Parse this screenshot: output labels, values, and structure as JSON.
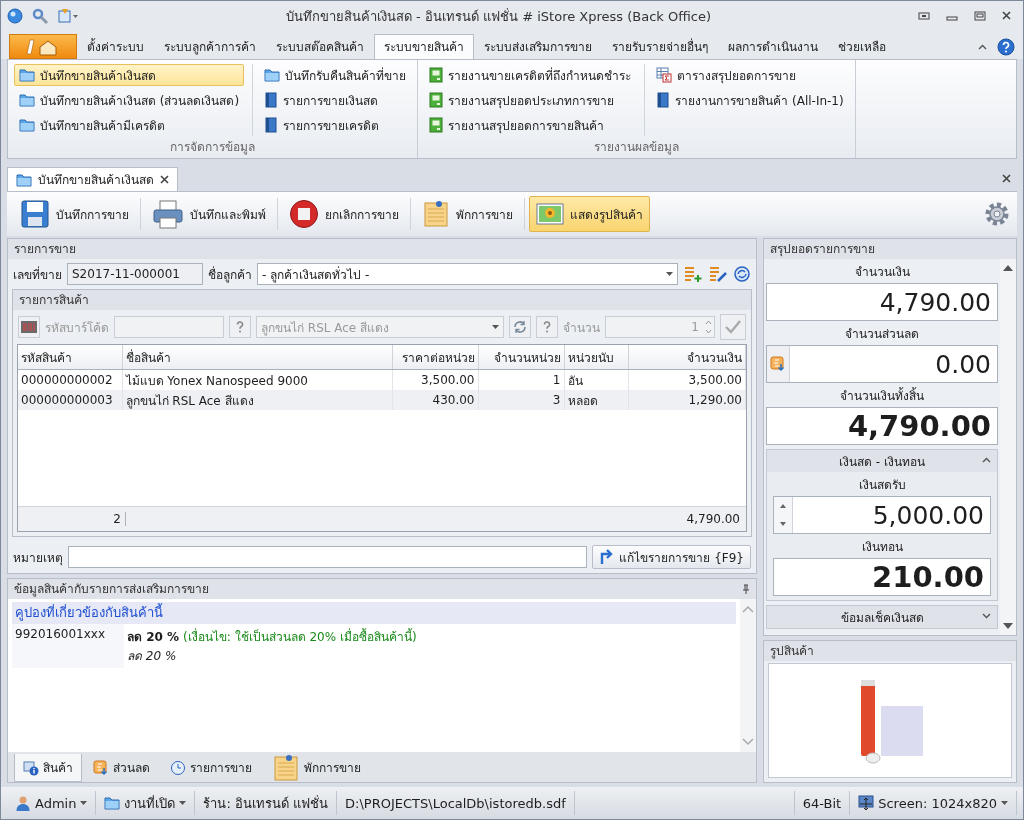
{
  "window": {
    "title": "บันทึกขายสินค้าเงินสด - อินเทรนด์ แฟชั่น # iStore Xpress (Back Office)"
  },
  "ribbon": {
    "tabs": [
      {
        "label": "ตั้งค่าระบบ",
        "selected": false
      },
      {
        "label": "ระบบลูกค้าการค้า",
        "selected": false
      },
      {
        "label": "ระบบสต๊อคสินค้า",
        "selected": false
      },
      {
        "label": "ระบบขายสินค้า",
        "selected": true
      },
      {
        "label": "ระบบส่งเสริมการขาย",
        "selected": false
      },
      {
        "label": "รายรับรายจ่ายอื่นๆ",
        "selected": false
      },
      {
        "label": "ผลการดำเนินงาน",
        "selected": false
      },
      {
        "label": "ช่วยเหลือ",
        "selected": false
      }
    ],
    "groups": [
      {
        "label": "การจัดการข้อมูล",
        "columns": [
          [
            {
              "label": "บันทึกขายสินค้าเงินสด",
              "kind": "folder",
              "selected": true
            },
            {
              "label": "บันทึกขายสินค้าเงินสด (ส่วนลดเงินสด)",
              "kind": "folder",
              "selected": false
            },
            {
              "label": "บันทึกขายสินค้ามีเครดิต",
              "kind": "folder",
              "selected": false
            }
          ],
          [
            {
              "label": "บันทึกรับคืนสินค้าที่ขาย",
              "kind": "folder",
              "selected": false
            },
            {
              "label": "รายการขายเงินสด",
              "kind": "book",
              "selected": false
            },
            {
              "label": "รายการขายเครดิต",
              "kind": "book",
              "selected": false
            }
          ]
        ]
      },
      {
        "label": "รายงานผลข้อมูล",
        "columns": [
          [
            {
              "label": "รายงานขายเครดิตที่ถึงกำหนดชำระ",
              "kind": "report",
              "selected": false
            },
            {
              "label": "รายงานสรุปยอดประเภทการขาย",
              "kind": "report",
              "selected": false
            },
            {
              "label": "รายงานสรุปยอดการขายสินค้า",
              "kind": "report",
              "selected": false
            }
          ],
          [
            {
              "label": "ตารางสรุปยอดการขาย",
              "kind": "table",
              "selected": false
            },
            {
              "label": "รายงานการขายสินค้า (All-In-1)",
              "kind": "book",
              "selected": false
            }
          ]
        ]
      }
    ]
  },
  "document_tab": {
    "label": "บันทึกขายสินค้าเงินสด"
  },
  "toolbar": [
    {
      "label": "บันทึกการขาย",
      "kind": "save",
      "on": false
    },
    {
      "label": "บันทึกและพิมพ์",
      "kind": "print",
      "on": false
    },
    {
      "label": "ยกเลิกการขาย",
      "kind": "stop",
      "on": false
    },
    {
      "label": "พักการขาย",
      "kind": "note",
      "on": false
    },
    {
      "label": "แสดงรูปสินค้า",
      "kind": "picture",
      "on": true
    }
  ],
  "sale": {
    "title": "รายการขาย",
    "number_label": "เลขที่ขาย",
    "number": "S2017-11-000001",
    "customer_label": "ชื่อลูกค้า",
    "customer": "- ลูกค้าเงินสดทั่วไป -"
  },
  "items": {
    "title": "รายการสินค้า",
    "entry": {
      "disabled": true,
      "barcode_label": "รหัสบาร์โค้ด",
      "product": "ลูกขนไก่ RSL Ace สีแดง",
      "qty_label": "จำนวน",
      "qty": "1"
    },
    "table": {
      "columns": [
        {
          "label": "รหัสสินค้า",
          "kind": "text"
        },
        {
          "label": "ชื่อสินค้า",
          "kind": "text"
        },
        {
          "label": "ราคาต่อหน่วย",
          "kind": "number"
        },
        {
          "label": "จำนวนหน่วย",
          "kind": "number"
        },
        {
          "label": "หน่วยนับ",
          "kind": "text"
        },
        {
          "label": "จำนวนเงิน",
          "kind": "number"
        }
      ],
      "rows": [
        [
          "000000000002",
          "ไม้แบด Yonex Nanospeed 9000",
          "3,500.00",
          "1",
          "อัน",
          "3,500.00"
        ],
        [
          "000000000003",
          "ลูกขนไก่ RSL Ace สีแดง",
          "430.00",
          "3",
          "หลอด",
          "1,290.00"
        ]
      ],
      "footer": {
        "count": "2",
        "total": "4,790.00"
      }
    }
  },
  "remark": {
    "label": "หมายเหตุ",
    "button": "แก้ไขรายการขาย {F9}"
  },
  "promo": {
    "title": "ข้อมูลสินค้ากับรายการส่งเสริมการขาย",
    "section": "คูปองที่เกี่ยวข้องกับสินค้านี้",
    "coupons": [
      {
        "code": "992016001xxx",
        "discount": "ลด 20 %",
        "condition": "(เงื่อนไข: ใช้เป็นส่วนลด 20% เมื่อซื้อสินค้านี้)",
        "note": "ลด 20 %"
      }
    ],
    "tabs": [
      {
        "label": "สินค้า",
        "kind": "info",
        "selected": true
      },
      {
        "label": "ส่วนลด",
        "kind": "discount",
        "selected": false
      },
      {
        "label": "รายการขาย",
        "kind": "history",
        "selected": false
      },
      {
        "label": "พักการขาย",
        "kind": "note",
        "selected": false
      }
    ]
  },
  "summary": {
    "title": "สรุปยอดรายการขาย",
    "fields": [
      {
        "label": "จำนวนเงิน",
        "value": "4,790.00",
        "kind": "plain"
      },
      {
        "label": "จำนวนส่วนลด",
        "value": "0.00",
        "kind": "discount"
      },
      {
        "label": "จำนวนเงินทั้งสิ้น",
        "value": "4,790.00",
        "kind": "total"
      }
    ],
    "groups": [
      {
        "title": "เงินสด - เงินทอน",
        "expanded": true,
        "fields": [
          {
            "label": "เงินสดรับ",
            "value": "5,000.00",
            "kind": "spin"
          },
          {
            "label": "เงินทอน",
            "value": "210.00",
            "kind": "total"
          }
        ]
      },
      {
        "title": "ข้อมลเช็คเงินสด",
        "expanded": false
      }
    ]
  },
  "picture": {
    "title": "รูปสินค้า"
  },
  "status_bar": [
    {
      "label": "Admin",
      "kind": "user"
    },
    {
      "label": "งานที่เปิด",
      "kind": "folder"
    },
    {
      "label": "ร้าน: อินเทรนด์ แฟชั่น",
      "kind": "text"
    },
    {
      "label": "D:\\PROJECTS\\LocalDb\\istoredb.sdf",
      "kind": "text"
    },
    {
      "label": "64-Bit",
      "kind": "text"
    },
    {
      "label": "Screen: 1024x820",
      "kind": "screen"
    }
  ]
}
